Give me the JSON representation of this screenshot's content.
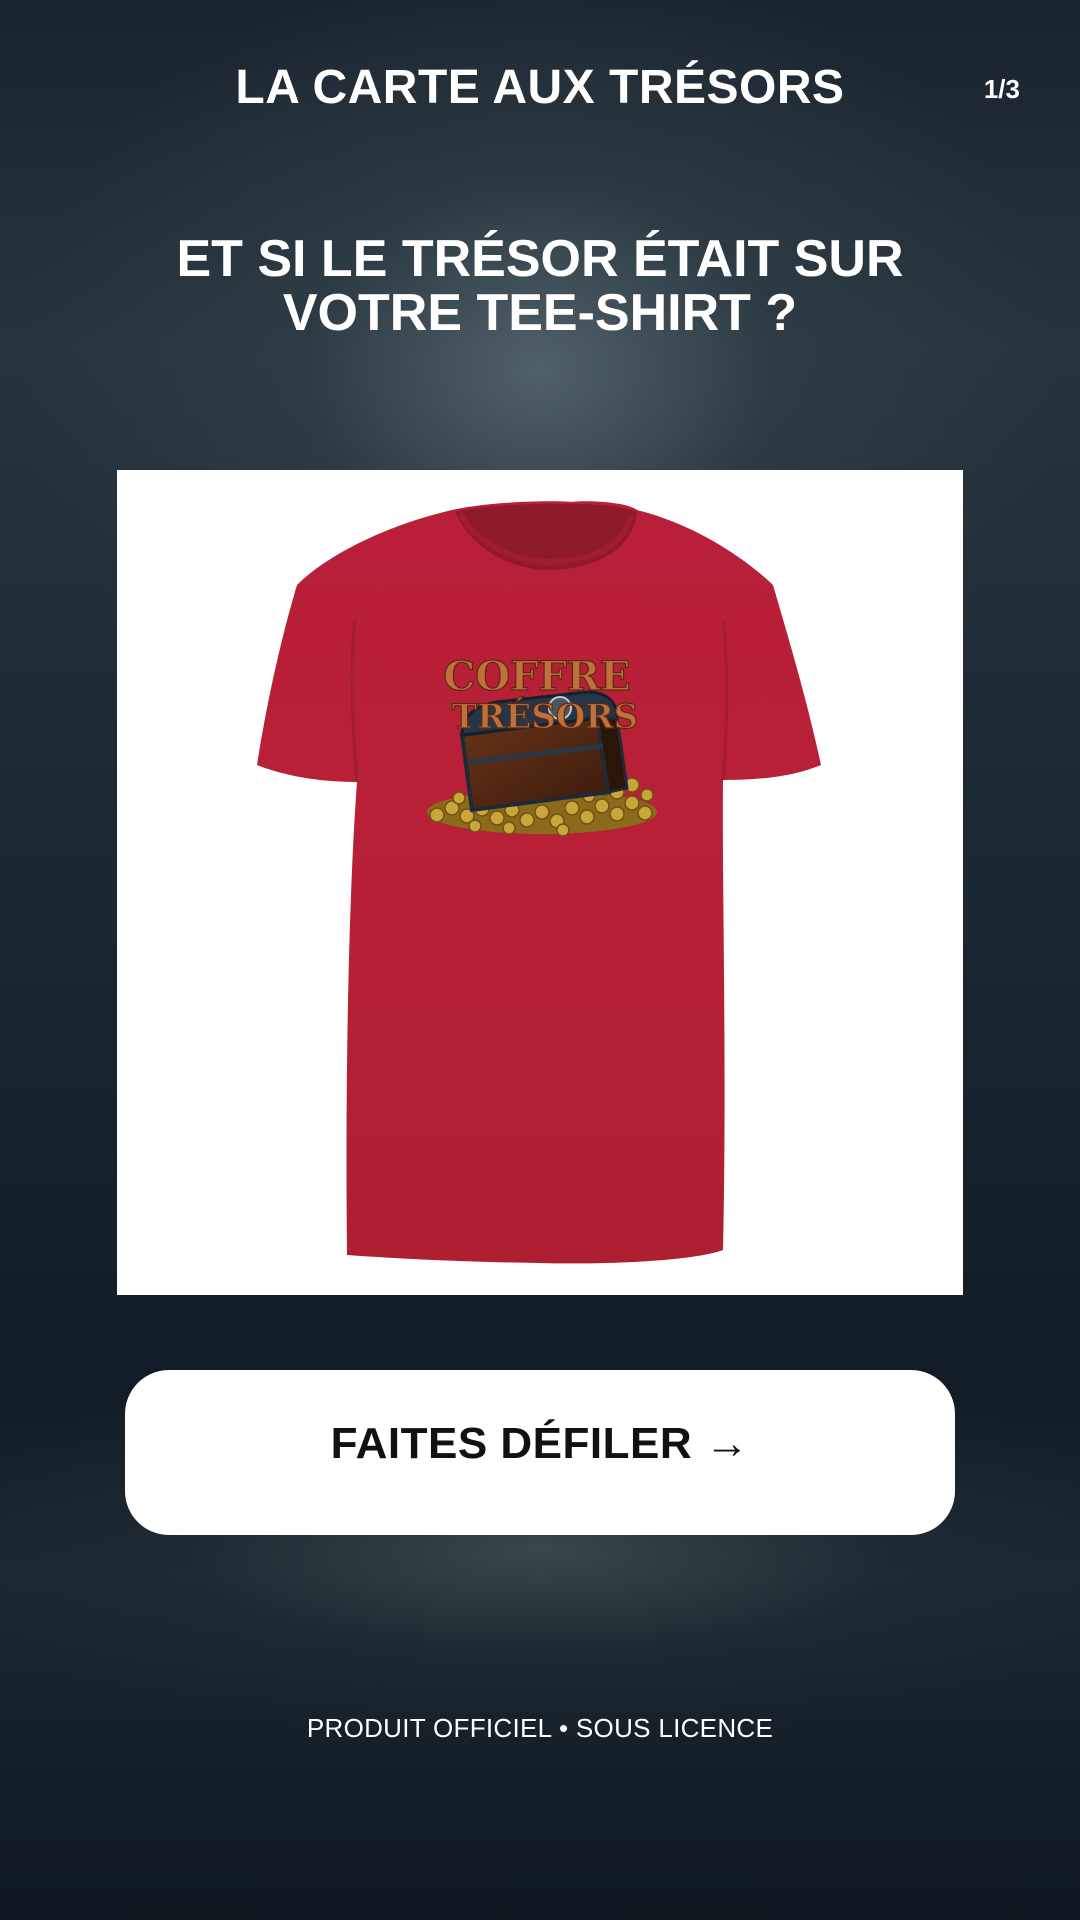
{
  "header": {
    "title": "LA CARTE AUX TRÉSORS",
    "page_counter": "1/3"
  },
  "headline": {
    "line1": "ET SI LE TRÉSOR ÉTAIT SUR",
    "line2": "VOTRE TEE-SHIRT ?"
  },
  "product": {
    "image": "red-tshirt-treasure-chest",
    "print_text_line1": "COFFRE",
    "print_text_line2": "TRÉSORS",
    "shirt_color": "#b91f38"
  },
  "cta": {
    "label": "FAITES DÉFILER →"
  },
  "footer": {
    "text": "PRODUIT OFFICIEL • SOUS LICENCE"
  }
}
